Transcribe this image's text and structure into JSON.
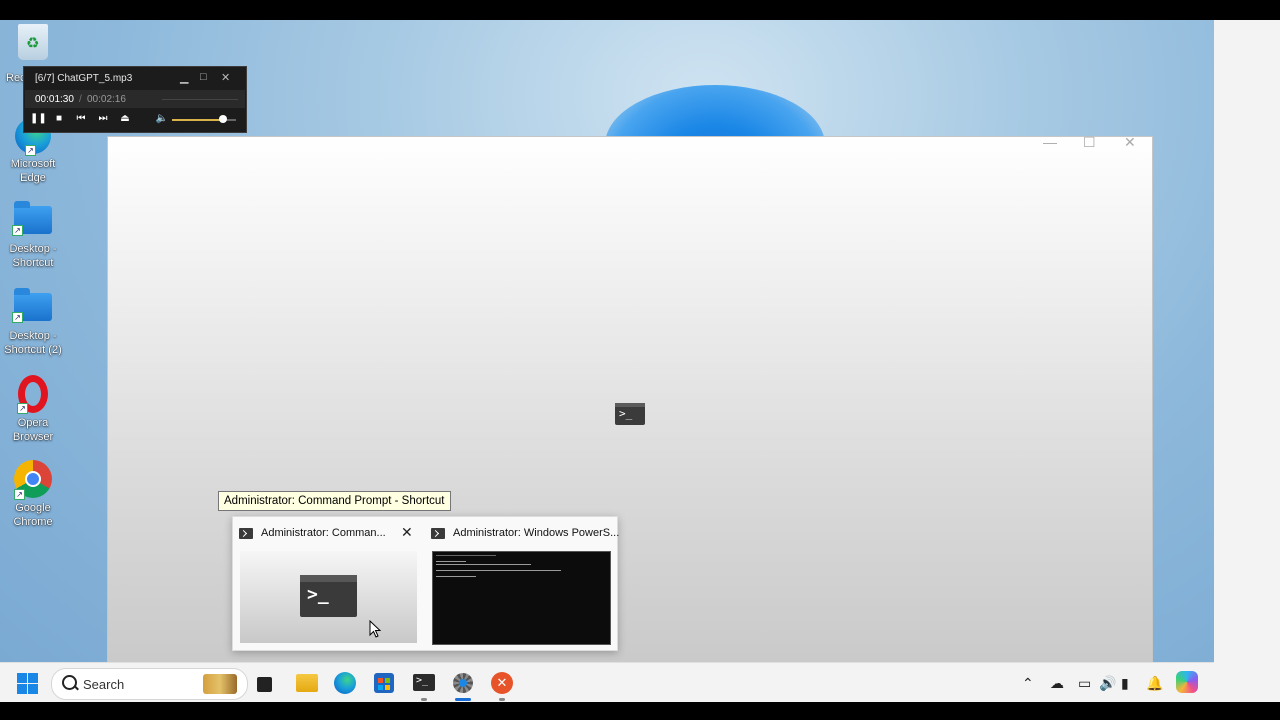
{
  "desktop": {
    "icons": [
      {
        "label": "Rec"
      },
      {
        "label": "Microsoft Edge"
      },
      {
        "label": "Desktop - Shortcut"
      },
      {
        "label": "Desktop - Shortcut (2)"
      },
      {
        "label": "Opera Browser"
      },
      {
        "label": "Google Chrome"
      }
    ]
  },
  "player": {
    "track_title": "[6/7] ChatGPT_5.mp3",
    "current_time": "00:01:30",
    "separator": "/",
    "total_time": "00:02:16",
    "volume_level": 0.85,
    "controls": {
      "pause": "pause-icon",
      "stop": "stop-icon",
      "prev": "previous-icon",
      "next": "next-icon",
      "eject": "eject-icon",
      "mute": "speaker-icon"
    }
  },
  "tooltip": {
    "text": "Administrator: Command Prompt - Shortcut"
  },
  "thumbnails": [
    {
      "title": "Administrator: Comman...",
      "close": "✕"
    },
    {
      "title": "Administrator: Windows PowerS..."
    }
  ],
  "taskbar": {
    "search_placeholder": "Search",
    "apps": [
      "start-icon",
      "file-explorer-icon",
      "edge-icon",
      "store-icon",
      "terminal-icon",
      "settings-icon",
      "close-app-icon"
    ]
  },
  "colors": {
    "accent": "#1a6fd6",
    "tooltip_bg": "#ffffe1",
    "player_bg": "#1c1c1c",
    "volume": "#d8b34a"
  }
}
